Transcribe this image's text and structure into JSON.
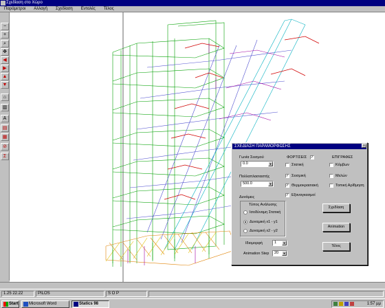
{
  "window": {
    "title": "Σχεδίαση στο Χώρο"
  },
  "menu": [
    "Παράμετροι",
    "Αλλαγή",
    "Σχεδίαση",
    "Εντολές",
    "Τέλος"
  ],
  "toolbar_icons": [
    "minus-icon",
    "plus-icon",
    "zoom-icon",
    "pan-icon",
    "arrow-left-icon",
    "arrow-right-icon",
    "arrow-up-icon",
    "arrow-down-icon",
    "view-icon",
    "building-icon",
    "text-a-icon",
    "chart-icon",
    "fill-icon",
    "stop-icon",
    "sigma-icon"
  ],
  "dialog": {
    "title": "ΣΧΕΔΙΑΣΗ ΠΑΡΑΜΟΡΦΩΣΗΣ",
    "angle_label": "Γωνία Σεισμού",
    "angle_value": "0.0",
    "multiplier_label": "Πολλαπλασιαστής",
    "multiplier_value": "500.0",
    "forces_group": "Δυνάμεις",
    "analysis_type_label": "Τύπος Ανάλυσης",
    "radio_options": [
      "Ισοδύναμη Στατική",
      "Δυναμική  x1 - y1",
      "Δυναμική  x2 - y2"
    ],
    "selected_radio": 1,
    "mode_label": "Ιδιομορφή",
    "mode_value": "1",
    "anim_step_label": "Animation Step",
    "anim_step_value": "20",
    "loads_header": "ΦΟΡΤΙΣΕΙΣ",
    "loads": [
      {
        "label": "Στατική",
        "checked": false
      },
      {
        "label": "Σεισμική",
        "checked": true
      },
      {
        "label": "Θερμοκρασιακή",
        "checked": true
      },
      {
        "label": "Εξαναγκασμοί",
        "checked": true
      }
    ],
    "labels_header": "ΕΠΙΓΡΑΦΕΣ",
    "labels": [
      {
        "label": "Κόμβων",
        "checked": false
      },
      {
        "label": "Μελών",
        "checked": false
      },
      {
        "label": "Τοπική Αρίθμηση",
        "checked": false
      }
    ],
    "draw_button": "Σχεδίαση",
    "animation_button": "Animation",
    "end_button": "Τέλος"
  },
  "status": {
    "coords": "1.25  22.22",
    "mode": "PILOS",
    "units": "S O P"
  },
  "taskbar": {
    "start": "Start",
    "word": "Microsoft Word",
    "statics": "Statics 98",
    "clock": "1:57 μμ"
  },
  "colors": {
    "title_bg": "#000080",
    "face": "#c0c0c0"
  }
}
